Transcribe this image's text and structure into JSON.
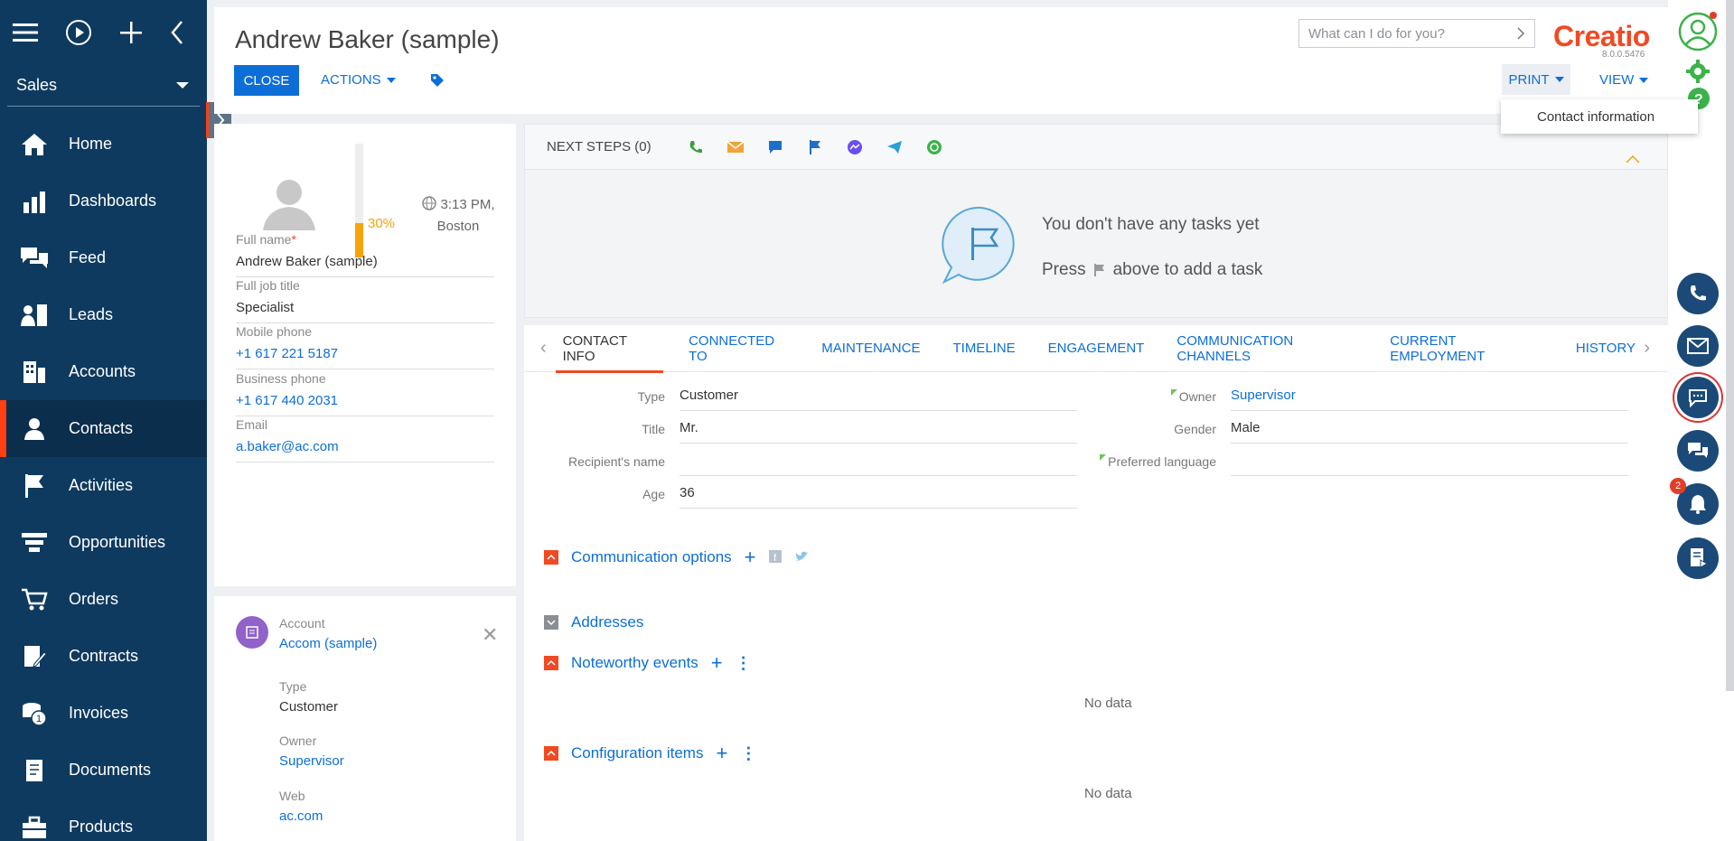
{
  "sidebar": {
    "workspace": "Sales",
    "items": [
      {
        "label": "Home",
        "icon": "home-icon"
      },
      {
        "label": "Dashboards",
        "icon": "dashboards-icon"
      },
      {
        "label": "Feed",
        "icon": "feed-icon"
      },
      {
        "label": "Leads",
        "icon": "leads-icon"
      },
      {
        "label": "Accounts",
        "icon": "accounts-icon"
      },
      {
        "label": "Contacts",
        "icon": "contacts-icon",
        "active": true
      },
      {
        "label": "Activities",
        "icon": "activities-icon"
      },
      {
        "label": "Opportunities",
        "icon": "opportunities-icon"
      },
      {
        "label": "Orders",
        "icon": "orders-icon"
      },
      {
        "label": "Contracts",
        "icon": "contracts-icon"
      },
      {
        "label": "Invoices",
        "icon": "invoices-icon"
      },
      {
        "label": "Documents",
        "icon": "documents-icon"
      },
      {
        "label": "Products",
        "icon": "products-icon"
      }
    ]
  },
  "header": {
    "title": "Andrew Baker (sample)",
    "close_label": "CLOSE",
    "actions_label": "ACTIONS",
    "search_placeholder": "What can I do for you?",
    "logo": "Creatio",
    "version": "8.0.0.5476",
    "print_label": "PRINT",
    "view_label": "VIEW",
    "print_menu": [
      "Contact information"
    ]
  },
  "profile": {
    "completeness_percent": 30,
    "completeness_label": "30%",
    "time": "3:13 PM,",
    "city": "Boston",
    "fields": [
      {
        "label": "Full name",
        "value": "Andrew Baker (sample)",
        "required": true
      },
      {
        "label": "Full job title",
        "value": "Specialist"
      },
      {
        "label": "Mobile phone",
        "value": "+1 617 221 5187",
        "link": true
      },
      {
        "label": "Business phone",
        "value": "+1 617 440 2031",
        "link": true
      },
      {
        "label": "Email",
        "value": "a.baker@ac.com",
        "link": true
      }
    ]
  },
  "account": {
    "account_label": "Account",
    "account_value": "Accom (sample)",
    "type_label": "Type",
    "type_value": "Customer",
    "owner_label": "Owner",
    "owner_value": "Supervisor",
    "web_label": "Web",
    "web_value": "ac.com"
  },
  "next_steps": {
    "title": "NEXT STEPS (0)",
    "empty_line1": "You don't have any tasks yet",
    "empty_press": "Press",
    "empty_after": "above to add a task"
  },
  "tabs": [
    "CONTACT INFO",
    "CONNECTED TO",
    "MAINTENANCE",
    "TIMELINE",
    "ENGAGEMENT",
    "COMMUNICATION CHANNELS",
    "CURRENT EMPLOYMENT",
    "HISTORY"
  ],
  "contact_info": {
    "type_label": "Type",
    "type_value": "Customer",
    "title_label": "Title",
    "title_value": "Mr.",
    "recipient_label": "Recipient's name",
    "recipient_value": "",
    "age_label": "Age",
    "age_value": "36",
    "owner_label": "Owner",
    "owner_value": "Supervisor",
    "gender_label": "Gender",
    "gender_value": "Male",
    "language_label": "Preferred language",
    "language_value": ""
  },
  "sections": {
    "communication": "Communication options",
    "addresses": "Addresses",
    "noteworthy": "Noteworthy events",
    "configuration": "Configuration items",
    "no_data": "No data"
  },
  "comm_panel": {
    "notifications_count": "2"
  },
  "colors": {
    "sidebar": "#0f3a5f",
    "accent": "#0d6ed8",
    "brand": "#f04a23",
    "progress": "#f5a40b"
  }
}
